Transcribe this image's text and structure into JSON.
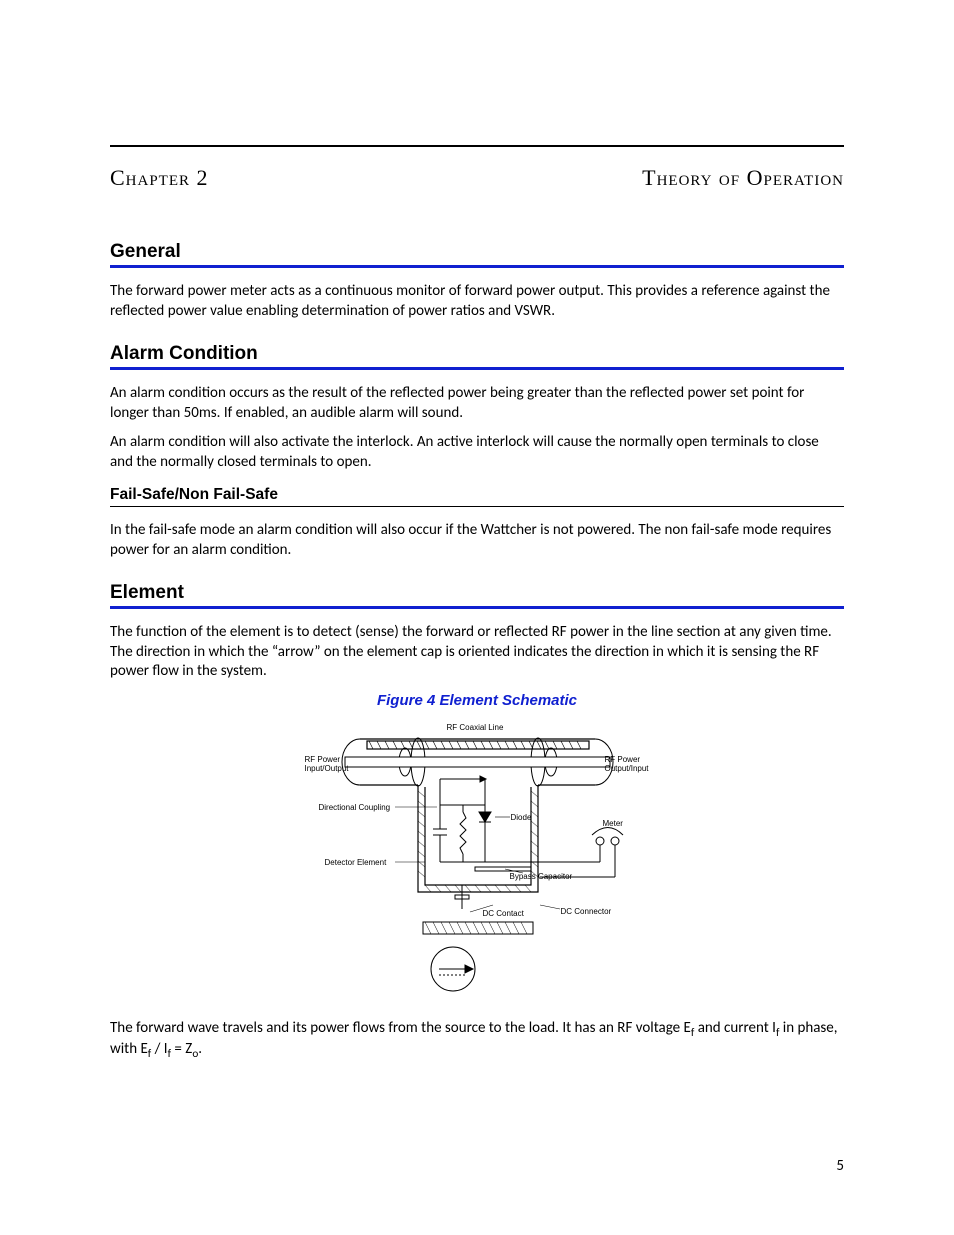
{
  "header": {
    "chapter": "Chapter 2",
    "title": "Theory of Operation"
  },
  "sections": {
    "general": {
      "heading": "General",
      "p1": "The forward power meter acts as a continuous monitor of forward power output. This provides a reference against the reflected power value enabling determination of power ratios and VSWR."
    },
    "alarm": {
      "heading": "Alarm Condition",
      "p1": "An alarm condition occurs as the result of the reflected power being greater than the reflected power set point for longer than 50ms. If enabled, an audible alarm will sound.",
      "p2": "An alarm condition will also activate the interlock. An active interlock will cause the normally open terminals to close and the normally closed terminals to open.",
      "sub": {
        "heading": "Fail-Safe/Non Fail-Safe",
        "p1": "In the fail-safe mode an alarm condition will also occur if the Wattcher is not powered. The non fail-safe mode requires power for an alarm condition."
      }
    },
    "element": {
      "heading": "Element",
      "p1": "The function of the element is to detect (sense) the forward or reflected RF power in the line section at any given time. The direction in which the “arrow” on the element cap is oriented indicates the direction in which it is sensing the RF power flow in the system.",
      "figure": {
        "caption": "Figure 4    Element Schematic",
        "labels": {
          "rf_coax": "RF Coaxial Line",
          "rf_in": "RF Power Input/Output",
          "rf_out": "RF Power Output/Input",
          "dir_coupling": "Directional Coupling",
          "diode": "Diode",
          "det_elem": "Detector Element",
          "bypass_cap": "Bypass Capacitor",
          "meter": "Meter",
          "dc_contact": "DC Contact",
          "dc_conn": "DC Connector"
        }
      },
      "p2_pre": "The forward wave travels and its power flows from the source to the load. It has an RF voltage E",
      "p2_sub1": "f",
      "p2_mid1": " and current I",
      "p2_sub2": "f",
      "p2_mid2": " in phase, with E",
      "p2_sub3": "f",
      "p2_mid3": " / I",
      "p2_sub4": "f",
      "p2_mid4": " = Z",
      "p2_sub5": "o",
      "p2_end": "."
    }
  },
  "page_number": "5"
}
